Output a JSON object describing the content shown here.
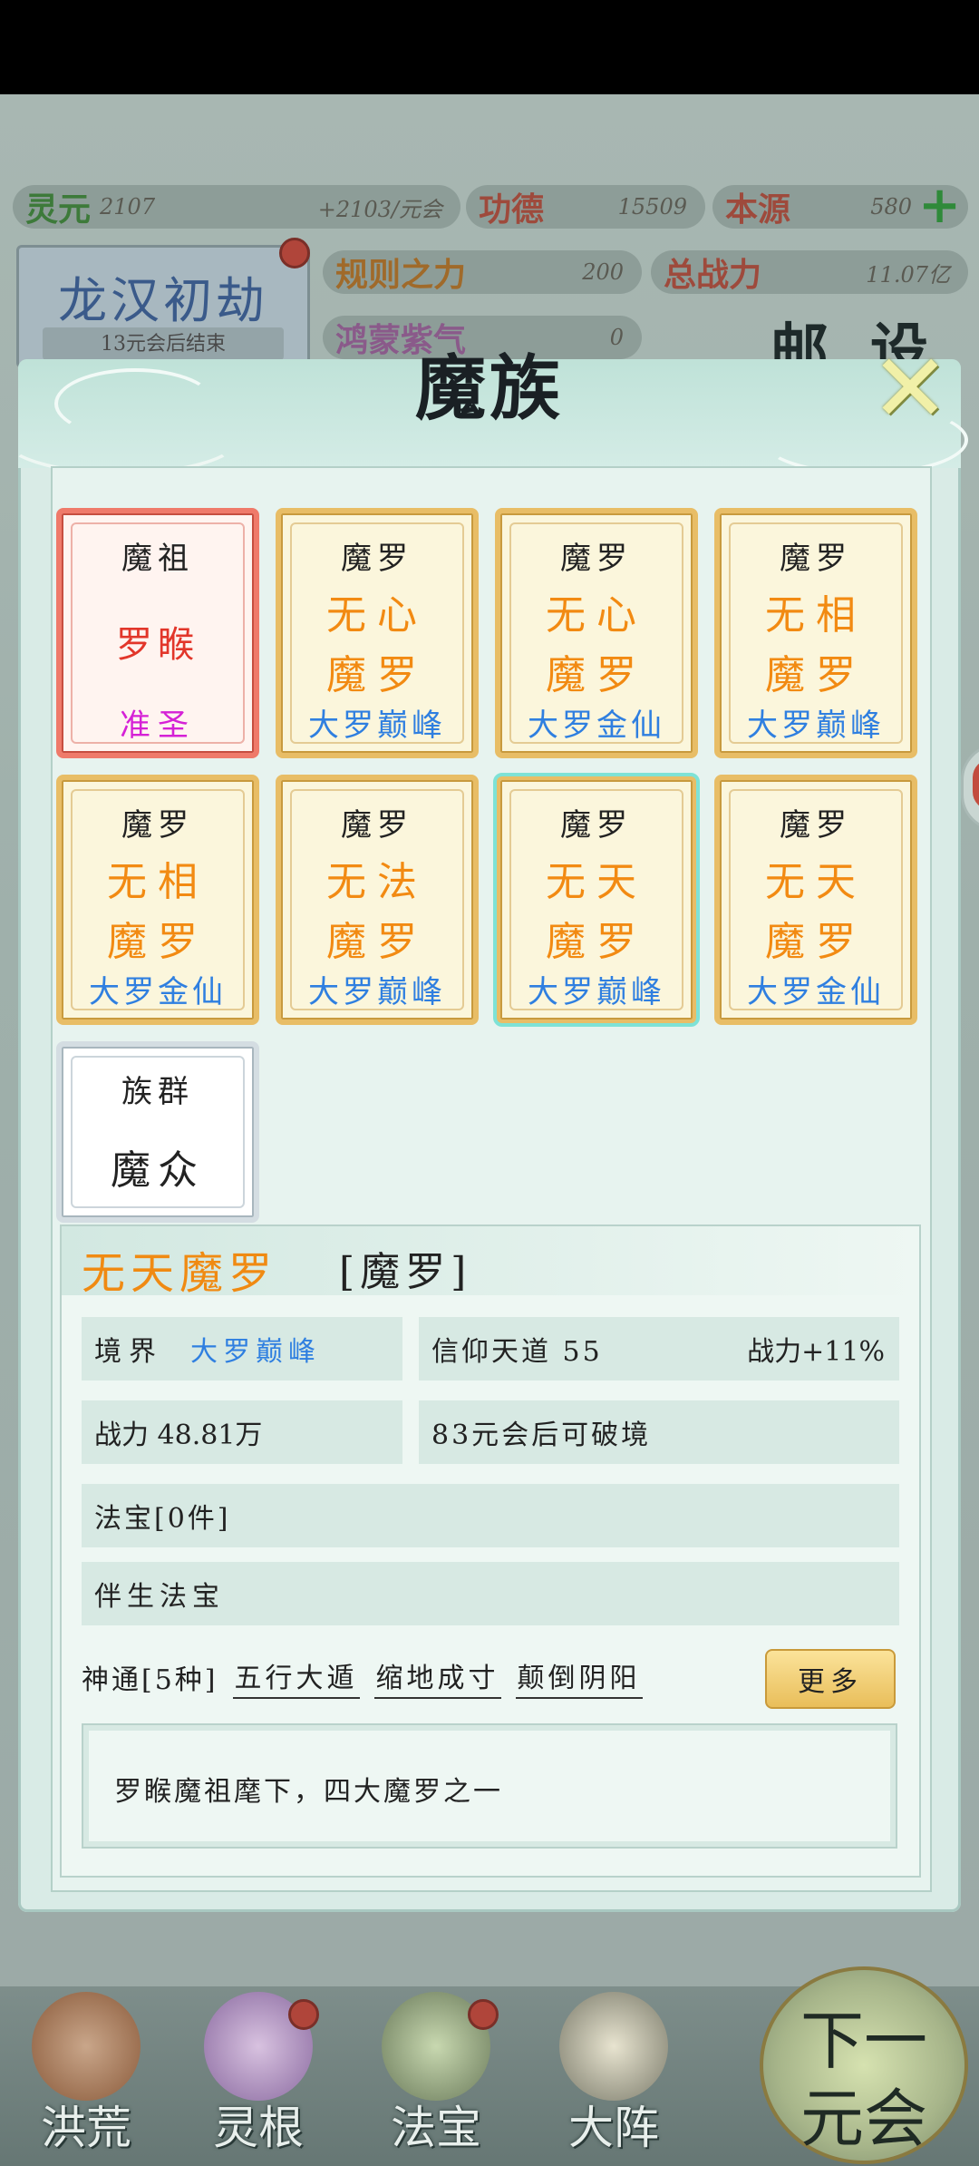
{
  "stats": {
    "lingyuan": {
      "label": "灵元",
      "value": "2107",
      "rate": "+2103/元会"
    },
    "gongde": {
      "label": "功德",
      "value": "15509"
    },
    "benyuan": {
      "label": "本源",
      "value": "580"
    },
    "guize": {
      "label": "规则之力",
      "value": "200"
    },
    "zongzhanli": {
      "label": "总战力",
      "value": "11.07亿"
    },
    "hongmeng": {
      "label": "鸿蒙紫气",
      "value": "0"
    }
  },
  "era": {
    "title": "龙汉初劫",
    "sub": "13元会后结束"
  },
  "bg_right_chars": [
    "邮",
    "设"
  ],
  "modal": {
    "title": "魔族",
    "close_glyph": "✕"
  },
  "cards": [
    {
      "type": "red",
      "l1": "魔祖",
      "l2": "罗睺",
      "l3": "",
      "l4": "准圣"
    },
    {
      "type": "gold",
      "l1": "魔罗",
      "l2": "无心",
      "l3": "魔罗",
      "l4": "大罗巅峰"
    },
    {
      "type": "gold",
      "l1": "魔罗",
      "l2": "无心",
      "l3": "魔罗",
      "l4": "大罗金仙"
    },
    {
      "type": "gold",
      "l1": "魔罗",
      "l2": "无相",
      "l3": "魔罗",
      "l4": "大罗巅峰"
    },
    {
      "type": "gold",
      "l1": "魔罗",
      "l2": "无相",
      "l3": "魔罗",
      "l4": "大罗金仙"
    },
    {
      "type": "gold",
      "l1": "魔罗",
      "l2": "无法",
      "l3": "魔罗",
      "l4": "大罗巅峰"
    },
    {
      "type": "gold",
      "l1": "魔罗",
      "l2": "无天",
      "l3": "魔罗",
      "l4": "大罗巅峰"
    },
    {
      "type": "gold",
      "l1": "魔罗",
      "l2": "无天",
      "l3": "魔罗",
      "l4": "大罗金仙"
    },
    {
      "type": "silver",
      "l1": "族群",
      "l2": "魔众",
      "l3": "",
      "l4": ""
    }
  ],
  "detail": {
    "name": "无天魔罗",
    "tag": "[魔罗]",
    "realm_label": "境界",
    "realm_value": "大罗巅峰",
    "faith": "信仰天道 55",
    "power_bonus": "战力+11%",
    "power": "战力 48.81万",
    "breakthrough": "83元会后可破境",
    "treasures": "法宝[0件]",
    "bound_treasure": "伴生法宝",
    "skills_label": "神通[5种]",
    "skills": [
      "五行大遁",
      "缩地成寸",
      "颠倒阴阳"
    ],
    "more_button": "更多",
    "description": "罗睺魔祖麾下，四大魔罗之一"
  },
  "nav": {
    "items": [
      "洪荒",
      "灵根",
      "法宝",
      "大阵"
    ],
    "next_line1": "下一",
    "next_line2": "元会"
  },
  "colors": {
    "gold_text": "#f28a12",
    "blue_text": "#2f7fe0",
    "red_name": "#e2362a",
    "purple_rank": "#d521d6",
    "modal_bg": "#d9ebe6"
  }
}
